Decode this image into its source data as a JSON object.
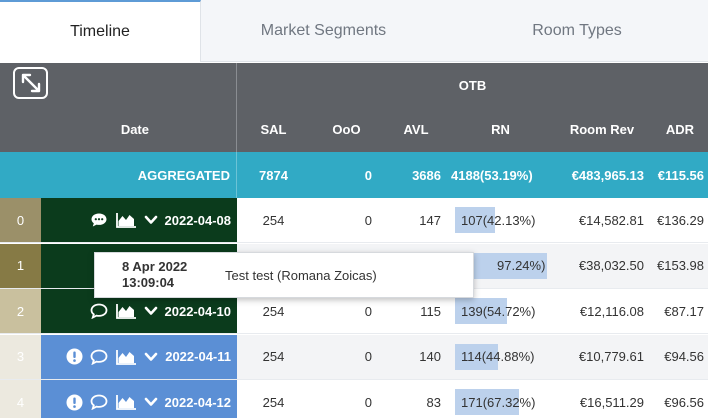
{
  "tabs": [
    {
      "label": "Timeline"
    },
    {
      "label": "Market Segments"
    },
    {
      "label": "Room Types"
    }
  ],
  "header": {
    "group_label": "OTB",
    "columns": {
      "date": "Date",
      "sal": "SAL",
      "ooo": "OoO",
      "avl": "AVL",
      "rn": "RN",
      "room_rev": "Room Rev",
      "adr": "ADR"
    }
  },
  "aggregated": {
    "label": "AGGREGATED",
    "sal": "7874",
    "ooo": "0",
    "avl": "3686",
    "rn": "4188(53.19%)",
    "room_rev": "€483,965.13",
    "adr": "€115.56"
  },
  "rows": [
    {
      "index": "0",
      "date": "2022-04-08",
      "sal": "254",
      "ooo": "0",
      "avl": "147",
      "rn": "107(42.13%)",
      "rn_pct": 42.13,
      "room_rev": "€14,582.81",
      "adr": "€136.29",
      "warning": false,
      "has_comment": true,
      "index_color": "#9b9069",
      "date_bg": "#0b3b1c"
    },
    {
      "index": "1",
      "date": "",
      "sal": "",
      "ooo": "",
      "avl": "",
      "rn": "97.24%)",
      "rn_pct": 97.24,
      "room_rev": "€38,032.50",
      "adr": "€153.98",
      "warning": false,
      "has_comment": false,
      "index_color": "#867a45",
      "date_bg": "#0b3b1c"
    },
    {
      "index": "2",
      "date": "2022-04-10",
      "sal": "254",
      "ooo": "0",
      "avl": "115",
      "rn": "139(54.72%)",
      "rn_pct": 54.72,
      "room_rev": "€12,116.08",
      "adr": "€87.17",
      "warning": false,
      "has_comment": false,
      "index_color": "#c9c09e",
      "date_bg": "#0b3b1c"
    },
    {
      "index": "3",
      "date": "2022-04-11",
      "sal": "254",
      "ooo": "0",
      "avl": "140",
      "rn": "114(44.88%)",
      "rn_pct": 44.88,
      "room_rev": "€10,779.61",
      "adr": "€94.56",
      "warning": true,
      "has_comment": false,
      "index_color": "#ece9df",
      "date_bg": "#5b8fd5"
    },
    {
      "index": "4",
      "date": "2022-04-12",
      "sal": "254",
      "ooo": "0",
      "avl": "83",
      "rn": "171(67.32%)",
      "rn_pct": 67.32,
      "room_rev": "€16,511.29",
      "adr": "€96.56",
      "warning": true,
      "has_comment": false,
      "index_color": "#ece9df",
      "date_bg": "#5b8fd5"
    }
  ],
  "tooltip": {
    "date": "8 Apr 2022",
    "time": "13:09:04",
    "text": "Test test (Romana Zoicas)"
  },
  "icons": {
    "expand": "expand-icon",
    "comment": "comment-icon",
    "chart": "area-chart-icon",
    "chevron": "chevron-down-icon",
    "warning": "warning-icon"
  },
  "colors": {
    "header_bg": "#5e6166",
    "aggregated_bg": "#31aac5",
    "rn_bar": "#bcd1ec",
    "active_tab_border": "#5e9bd6"
  }
}
